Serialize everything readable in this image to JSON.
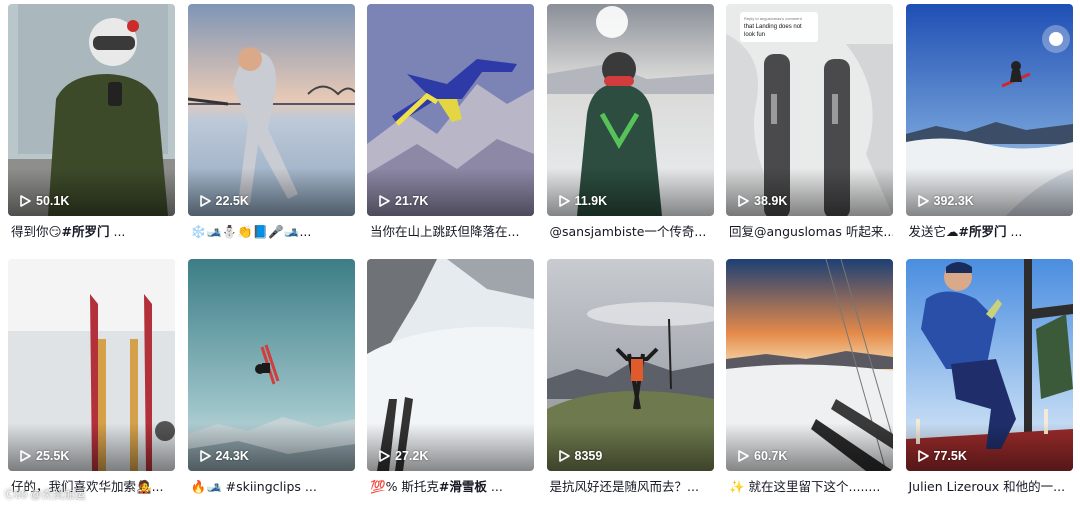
{
  "videos": [
    {
      "views": "50.1K",
      "caption_pre": "得到你😏",
      "caption_tag": "#所罗门",
      "caption_post": " ..."
    },
    {
      "views": "22.5K",
      "caption_pre": "❄️🎿⛄👏📘🎤🎿...",
      "caption_tag": "",
      "caption_post": ""
    },
    {
      "views": "21.7K",
      "caption_pre": "当你在山上跳跃但降落在...",
      "caption_tag": "",
      "caption_post": ""
    },
    {
      "views": "11.9K",
      "caption_pre": "@sansjambiste一个传奇...",
      "caption_tag": "",
      "caption_post": ""
    },
    {
      "views": "38.9K",
      "caption_pre": "回复@anguslomas 听起来...",
      "caption_tag": "",
      "caption_post": "",
      "overlay_small": "Reply to anguslomas's comment",
      "overlay_main": "that Landing does not look fun"
    },
    {
      "views": "392.3K",
      "caption_pre": "发送它☁",
      "caption_tag": "#所罗门",
      "caption_post": " ..."
    },
    {
      "views": "25.5K",
      "caption_pre": "仔的，我们喜欢华加索🧑‍🎤...",
      "caption_tag": "",
      "caption_post": "",
      "watermark": "Ⓒ00 @杰贸加运"
    },
    {
      "views": "24.3K",
      "caption_pre": "🔥🎿 #skiingclips ...",
      "caption_tag": "",
      "caption_post": ""
    },
    {
      "views": "27.2K",
      "caption_pre": "💯% 斯托克",
      "caption_tag": "#滑雪板",
      "caption_post": " ..."
    },
    {
      "views": "8359",
      "caption_pre": "是抗风好还是随风而去？...",
      "caption_tag": "",
      "caption_post": ""
    },
    {
      "views": "60.7K",
      "caption_pre": "✨ 就在这里留下这个........",
      "caption_tag": "",
      "caption_post": ""
    },
    {
      "views": "77.5K",
      "caption_pre": "Julien Lizeroux 和他的一...",
      "caption_tag": "",
      "caption_post": ""
    }
  ],
  "colors": {
    "caption": "#161823",
    "views": "#ffffff"
  },
  "icons": {
    "views": "play-icon"
  }
}
